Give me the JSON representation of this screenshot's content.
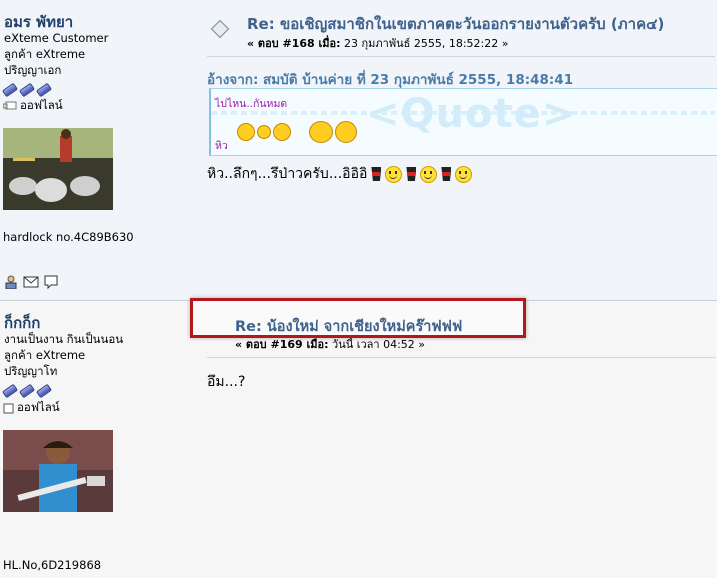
{
  "post1": {
    "poster": {
      "name": "อมร พัทยา",
      "title": "eXteme Customer",
      "group": "ลูกค้า eXtreme",
      "rank": "ปริญญาเอก",
      "status": "ออฟไลน์",
      "signature": "hardlock no.4C89B630"
    },
    "subject": "Re: ขอเชิญสมาชิกในเขตภาคตะวันออกรายงานตัวครับ (ภาค๔)",
    "meta_prefix": "« ตอบ #168 เมื่อ:",
    "meta_date": " 23 กุมภาพันธ์ 2555, 18:52:22 »",
    "quote_header": "อ้างจาก: สมบัติ บ้านค่าย ที่ 23 กุมภาพันธ์ 2555, 18:48:41",
    "quote_line1": "ไปไหน..กันหมด",
    "quote_line2": "หิว",
    "quote_watermark": "<Quote>",
    "message": "หิว..ลึกๆ...รึป่าวครับ...อิอิอิ"
  },
  "post2": {
    "poster": {
      "name": "ก็กก็ก",
      "title": "งานเป็นงาน กินเป็นนอน",
      "group": "ลูกค้า eXtreme",
      "rank": "ปริญญาโท",
      "status": "ออฟไลน์",
      "signature": "HL.No,6D219868"
    },
    "subject": "Re: น้องใหม่ จากเชียงใหม่คร๊าฟฟฟ",
    "meta_prefix": "« ตอบ #169 เมื่อ:",
    "meta_date": " วันนี้ เวลา 04:52 »",
    "message": "อึม...?"
  },
  "colors": {
    "username": "#21416a",
    "subject": "#3f628d",
    "quote_header": "#4a7bab",
    "highlight_border": "#b3161c"
  }
}
